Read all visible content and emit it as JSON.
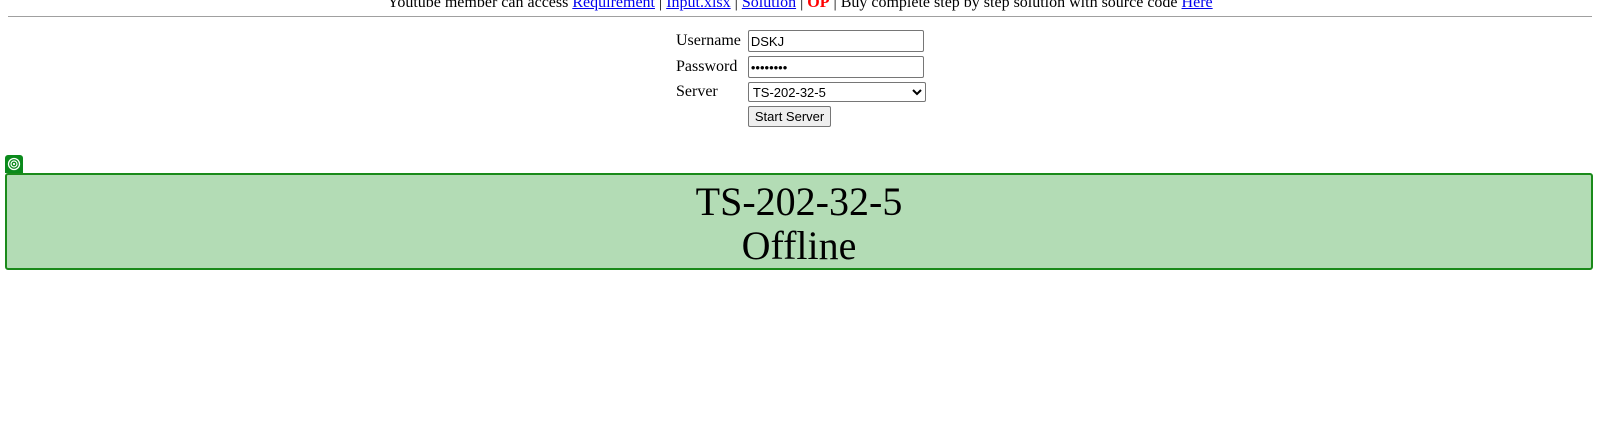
{
  "top_bar": {
    "prefix": "Youtube member can access ",
    "link_requirement": "Requirement",
    "sep1": " | ",
    "link_input": "Input.xlsx",
    "sep2": " | ",
    "link_solution": "Solution",
    "sep3": " | ",
    "op_label": "OP",
    "middle": " | Buy complete step by step solution with source code ",
    "link_here": "Here"
  },
  "form": {
    "username_label": "Username",
    "username_value": "DSKJ",
    "password_label": "Password",
    "password_value": "password",
    "server_label": "Server",
    "server_selected": "TS-202-32-5",
    "start_button": "Start Server"
  },
  "status_panel": {
    "icon": "target-icon",
    "server_name": "TS-202-32-5",
    "status": "Offline",
    "background_color": "#b3dcb5",
    "border_color": "#1a8a1a"
  }
}
